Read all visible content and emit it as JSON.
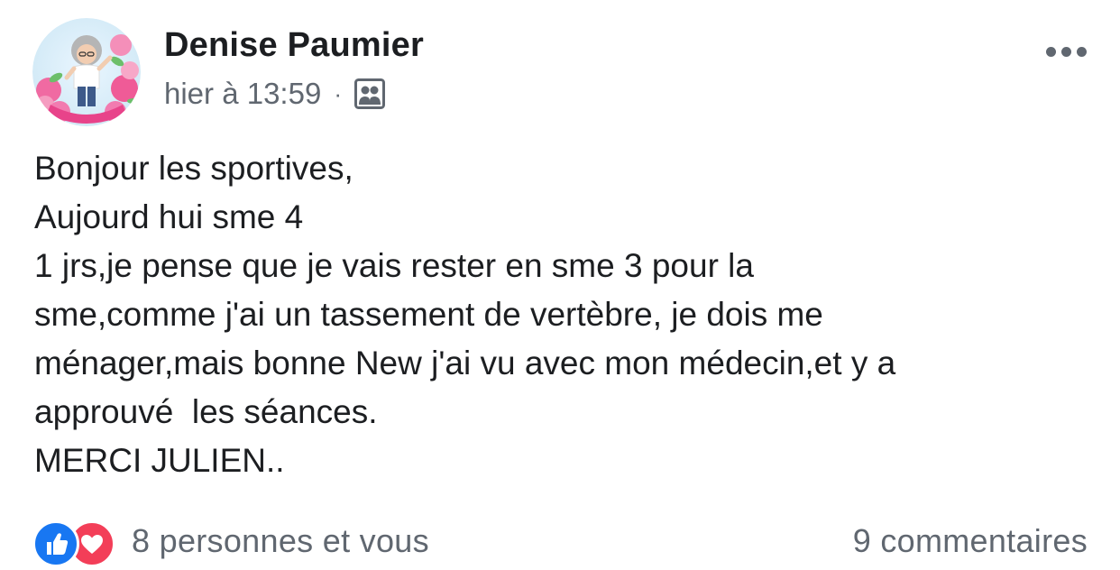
{
  "post": {
    "author": "Denise Paumier",
    "timestamp": "hier à 13:59",
    "separator": "·",
    "audience_icon": "group-audience-icon",
    "more_icon": "more-options-icon",
    "message_lines": [
      "Bonjour les sportives,",
      "Aujourd hui sme 4",
      "1 jrs,je pense que je vais rester en sme 3 pour la",
      "sme,comme j'ai un tassement de vertèbre, je dois me",
      "ménager,mais bonne New j'ai vu avec mon médecin,et y a",
      "approuvé  les séances.",
      "MERCI JULIEN.."
    ],
    "reactions": {
      "icons": [
        "like-reaction-icon",
        "love-reaction-icon"
      ],
      "text": "8 personnes et vous"
    },
    "comments": "9 commentaires",
    "colors": {
      "like": "#1877f2",
      "love": "#f33e58",
      "secondary_text": "#606770"
    }
  }
}
